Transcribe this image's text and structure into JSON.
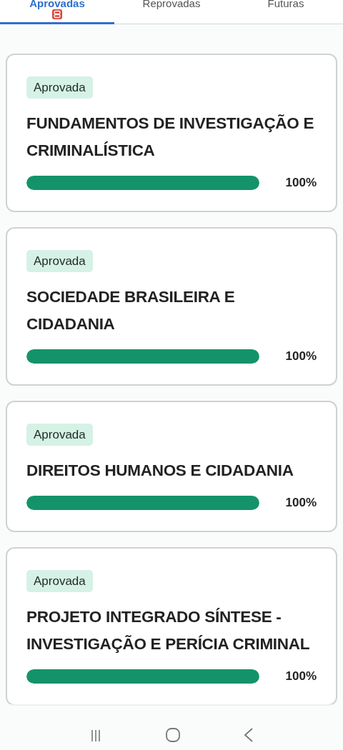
{
  "tabs": [
    {
      "label": "Aprovadas",
      "selected": true,
      "badge": true
    },
    {
      "label": "Reprovadas",
      "selected": false,
      "badge": false
    },
    {
      "label": "Futuras",
      "selected": false,
      "badge": false
    }
  ],
  "courses": [
    {
      "status": "Aprovada",
      "title": "FUNDAMENTOS DE INVESTIGAÇÃO E CRIMINALÍSTICA",
      "level": 1,
      "reading": "100%"
    },
    {
      "status": "Aprovada",
      "title": "SOCIEDADE BRASILEIRA E CIDADANIA",
      "level": 1,
      "reading": "100%"
    },
    {
      "status": "Aprovada",
      "title": "DIREITOS HUMANOS E CIDADANIA",
      "level": 1,
      "reading": "100%"
    },
    {
      "status": "Aprovada",
      "title": "PROJETO INTEGRADO SÍNTESE - INVESTIGAÇÃO E PERÍCIA CRIMINAL",
      "level": 1,
      "reading": "100%"
    }
  ]
}
